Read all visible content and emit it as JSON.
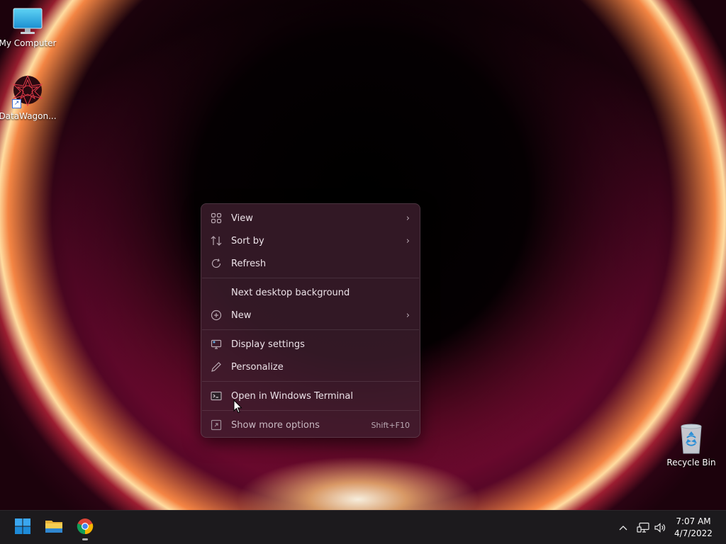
{
  "desktop": {
    "icons": [
      {
        "label": "My Computer"
      },
      {
        "label": "DataWagon..."
      },
      {
        "label": "Recycle Bin"
      }
    ]
  },
  "context_menu": {
    "items": [
      {
        "label": "View",
        "icon": "view-icon",
        "submenu": true
      },
      {
        "label": "Sort by",
        "icon": "sort-icon",
        "submenu": true
      },
      {
        "label": "Refresh",
        "icon": "refresh-icon"
      },
      {
        "label": "Next desktop background"
      },
      {
        "label": "New",
        "icon": "new-icon",
        "submenu": true
      },
      {
        "label": "Display settings",
        "icon": "display-icon"
      },
      {
        "label": "Personalize",
        "icon": "pen-icon"
      },
      {
        "label": "Open in Windows Terminal",
        "icon": "terminal-icon"
      },
      {
        "label": "Show more options",
        "icon": "show-more-icon",
        "shortcut": "Shift+F10"
      }
    ]
  },
  "taskbar": {
    "apps": [
      "start-icon",
      "file-explorer-icon",
      "chrome-icon"
    ],
    "tray": [
      "chevron-up-icon",
      "network-icon",
      "volume-icon"
    ],
    "clock": {
      "time": "7:07 AM",
      "date": "4/7/2022"
    }
  },
  "colors": {
    "taskbar_bg": "#1c1a1d",
    "menu_bg": "#3e1e2e",
    "accent": "#0078d4"
  }
}
